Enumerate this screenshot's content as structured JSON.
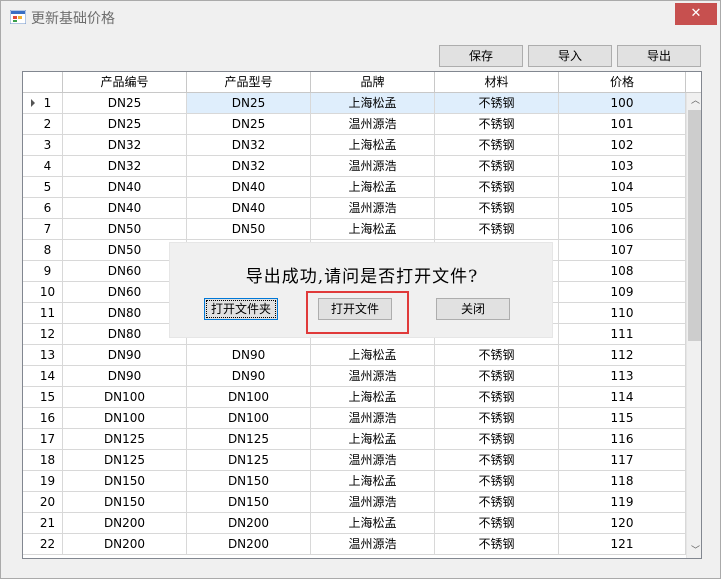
{
  "window": {
    "title": "更新基础价格",
    "close_glyph": "✕"
  },
  "toolbar": {
    "save_label": "保存",
    "import_label": "导入",
    "export_label": "导出"
  },
  "table": {
    "headers": [
      "",
      "产品编号",
      "产品型号",
      "品牌",
      "材料",
      "价格"
    ],
    "rows": [
      [
        "1",
        "DN25",
        "DN25",
        "上海松孟",
        "不锈钢",
        "100"
      ],
      [
        "2",
        "DN25",
        "DN25",
        "温州源浩",
        "不锈钢",
        "101"
      ],
      [
        "3",
        "DN32",
        "DN32",
        "上海松孟",
        "不锈钢",
        "102"
      ],
      [
        "4",
        "DN32",
        "DN32",
        "温州源浩",
        "不锈钢",
        "103"
      ],
      [
        "5",
        "DN40",
        "DN40",
        "上海松孟",
        "不锈钢",
        "104"
      ],
      [
        "6",
        "DN40",
        "DN40",
        "温州源浩",
        "不锈钢",
        "105"
      ],
      [
        "7",
        "DN50",
        "DN50",
        "上海松孟",
        "不锈钢",
        "106"
      ],
      [
        "8",
        "DN50",
        "",
        "",
        "",
        "107"
      ],
      [
        "9",
        "DN60",
        "",
        "",
        "",
        "108"
      ],
      [
        "10",
        "DN60",
        "",
        "",
        "",
        "109"
      ],
      [
        "11",
        "DN80",
        "",
        "",
        "",
        "110"
      ],
      [
        "12",
        "DN80",
        "",
        "",
        "",
        "111"
      ],
      [
        "13",
        "DN90",
        "DN90",
        "上海松孟",
        "不锈钢",
        "112"
      ],
      [
        "14",
        "DN90",
        "DN90",
        "温州源浩",
        "不锈钢",
        "113"
      ],
      [
        "15",
        "DN100",
        "DN100",
        "上海松孟",
        "不锈钢",
        "114"
      ],
      [
        "16",
        "DN100",
        "DN100",
        "温州源浩",
        "不锈钢",
        "115"
      ],
      [
        "17",
        "DN125",
        "DN125",
        "上海松孟",
        "不锈钢",
        "116"
      ],
      [
        "18",
        "DN125",
        "DN125",
        "温州源浩",
        "不锈钢",
        "117"
      ],
      [
        "19",
        "DN150",
        "DN150",
        "上海松孟",
        "不锈钢",
        "118"
      ],
      [
        "20",
        "DN150",
        "DN150",
        "温州源浩",
        "不锈钢",
        "119"
      ],
      [
        "21",
        "DN200",
        "DN200",
        "上海松孟",
        "不锈钢",
        "120"
      ],
      [
        "22",
        "DN200",
        "DN200",
        "温州源浩",
        "不锈钢",
        "121"
      ]
    ],
    "selected_row": 0
  },
  "dialog": {
    "message": "导出成功,请问是否打开文件?",
    "open_folder_label": "打开文件夹",
    "open_file_label": "打开文件",
    "close_label": "关闭"
  },
  "scrollbar": {
    "up_glyph": "︿",
    "down_glyph": "﹀"
  },
  "colors": {
    "close_bg": "#c7504f",
    "selection": "#dfeefc",
    "highlight": "#e03a3a"
  }
}
